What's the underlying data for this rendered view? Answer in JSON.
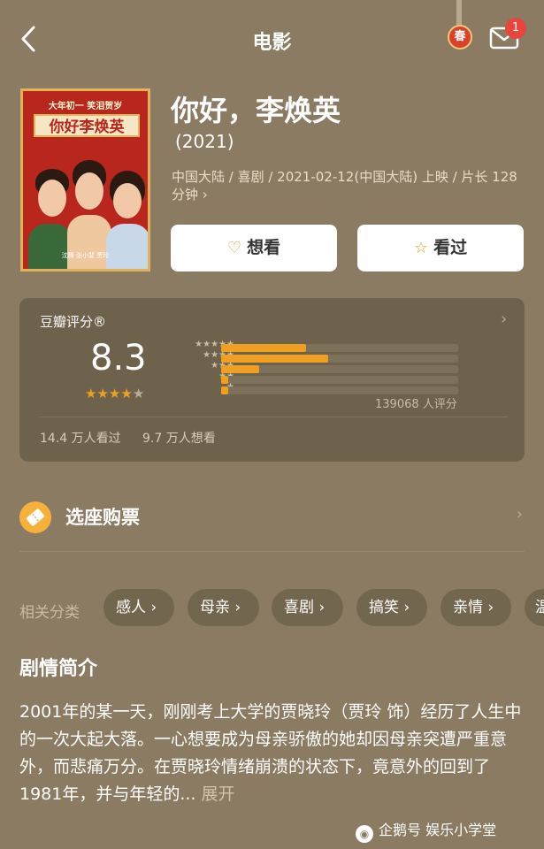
{
  "header": {
    "title": "电影",
    "spring_badge": "春",
    "notification_count": "1"
  },
  "poster": {
    "tagline": "大年初一 笑泪贺岁",
    "title": "你好李焕英",
    "credits": "沈腾  张小斐  贾玲"
  },
  "movie": {
    "name": "你好，李焕英",
    "year": "(2021)",
    "meta": "中国大陆 / 喜剧 / 2021-02-12(中国大陆) 上映 / 片长 128 分钟 ›"
  },
  "actions": {
    "want": "想看",
    "seen": "看过"
  },
  "rating": {
    "title": "豆瓣评分®",
    "score": "8.3",
    "stars_filled": 4,
    "stars_total": 5,
    "distribution": [
      {
        "stars": "★★★★★",
        "fraction": 0.36
      },
      {
        "stars": "★★★★",
        "fraction": 0.45
      },
      {
        "stars": "★★★",
        "fraction": 0.16
      },
      {
        "stars": "★★",
        "fraction": 0.03
      },
      {
        "stars": "★",
        "fraction": 0.03
      }
    ],
    "count": "139068 人评分",
    "watched": "14.4 万人看过",
    "wanted": "9.7 万人想看"
  },
  "ticket": {
    "label": "选座购票"
  },
  "categories": {
    "label": "相关分类",
    "items": [
      "感人 ›",
      "母亲 ›",
      "喜剧 ›",
      "搞笑 ›",
      "亲情 ›",
      "温"
    ]
  },
  "synopsis": {
    "title": "剧情简介",
    "text": "2001年的某一天，刚刚考上大学的贾晓玲（贾玲 饰）经历了人生中的一次大起大落。一心想要成为母亲骄傲的她却因母亲突遭严重意外，而悲痛万分。在贾晓玲情绪崩溃的状态下，竟意外的回到了1981年，并与年轻的...",
    "more": "展开"
  },
  "watermark": {
    "text": "企鹅号 娱乐小学堂"
  },
  "colors": {
    "accent": "#f0a020",
    "background": "#8a7b62"
  }
}
